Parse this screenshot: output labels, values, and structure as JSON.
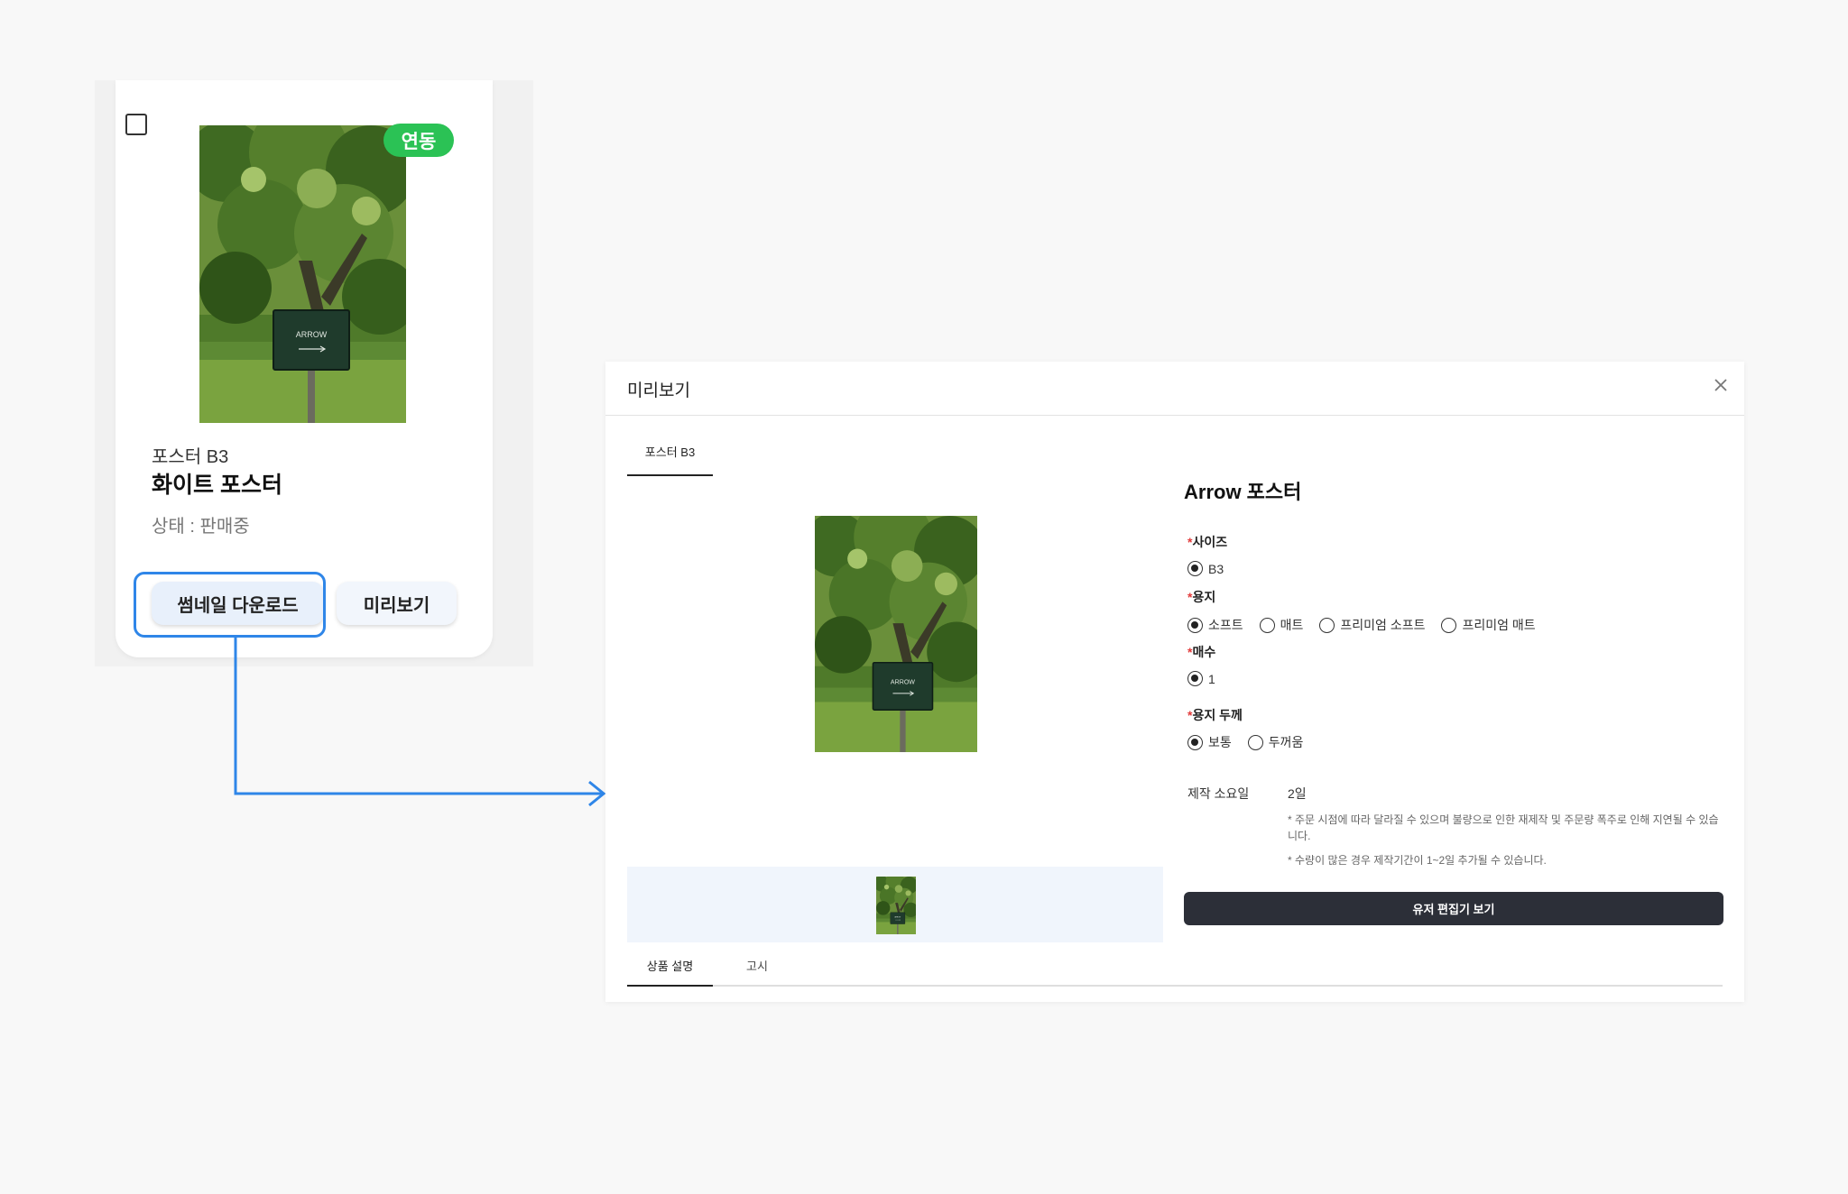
{
  "card": {
    "badge": "연동",
    "subtitle": "포스터 B3",
    "title": "화이트 포스터",
    "status": "상태 : 판매중",
    "thumbnail_download_label": "썸네일 다운로드",
    "preview_label": "미리보기",
    "image_sign_text": "ARROW"
  },
  "modal": {
    "title": "미리보기",
    "top_tab": "포스터 B3",
    "product_title": "Arrow 포스터",
    "options": {
      "size": {
        "label": "사이즈",
        "choices": [
          "B3"
        ],
        "selected": "B3"
      },
      "paper": {
        "label": "용지",
        "choices": [
          "소프트",
          "매트",
          "프리미엄 소프트",
          "프리미엄 매트"
        ],
        "selected": "소프트"
      },
      "quantity": {
        "label": "매수",
        "choices": [
          "1"
        ],
        "selected": "1"
      },
      "thickness": {
        "label": "용지 두께",
        "choices": [
          "보통",
          "두꺼움"
        ],
        "selected": "보통"
      }
    },
    "production": {
      "label": "제작 소요일",
      "value": "2일",
      "note1": "* 주문 시점에 따라 달라질 수 있으며 불량으로 인한 재제작 및 주문량 폭주로 인해 지연될 수 있습니다.",
      "note2": "* 수량이 많은 경우 제작기간이 1~2일 추가될 수 있습니다."
    },
    "editor_button": "유저 편집기 보기",
    "bottom_tabs": [
      "상품 설명",
      "고시"
    ]
  },
  "colors": {
    "badge_green": "#2bc255",
    "highlight_blue": "#2f86e8",
    "editor_button_bg": "#2c2f38",
    "required_star": "#e23a3a"
  }
}
